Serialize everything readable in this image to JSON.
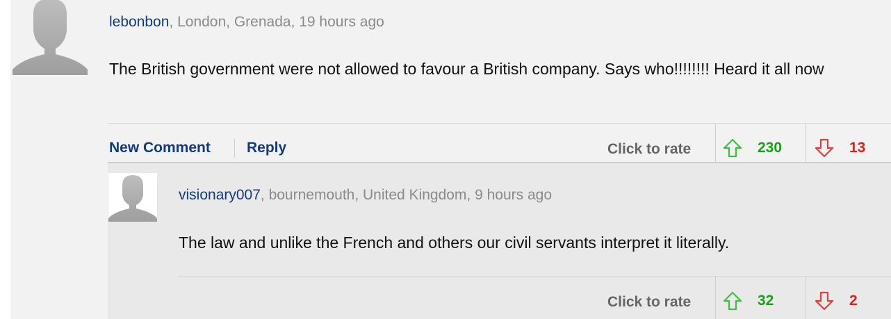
{
  "comment": {
    "username": "lebonbon",
    "location_time": ", London, Grenada, 19 hours ago",
    "body": "The British government were not allowed to favour a British company. Says who!!!!!!!! Heard it all now",
    "actions": {
      "new_comment": "New Comment",
      "reply": "Reply"
    },
    "rating": {
      "label": "Click to rate",
      "up_count": "230",
      "down_count": "13"
    }
  },
  "reply": {
    "username": "visionary007",
    "location_time": ", bournemouth, United Kingdom, 9 hours ago",
    "body": "The law and unlike the French and others our civil servants interpret it literally.",
    "rating": {
      "label": "Click to rate",
      "up_count": "32",
      "down_count": "2"
    }
  },
  "colors": {
    "username": "#123b7e",
    "up_vote": "#1aa01a",
    "down_vote": "#e0201a"
  },
  "icons": {
    "avatar": "avatar-silhouette-icon",
    "up": "arrow-up-icon",
    "down": "arrow-down-icon"
  }
}
